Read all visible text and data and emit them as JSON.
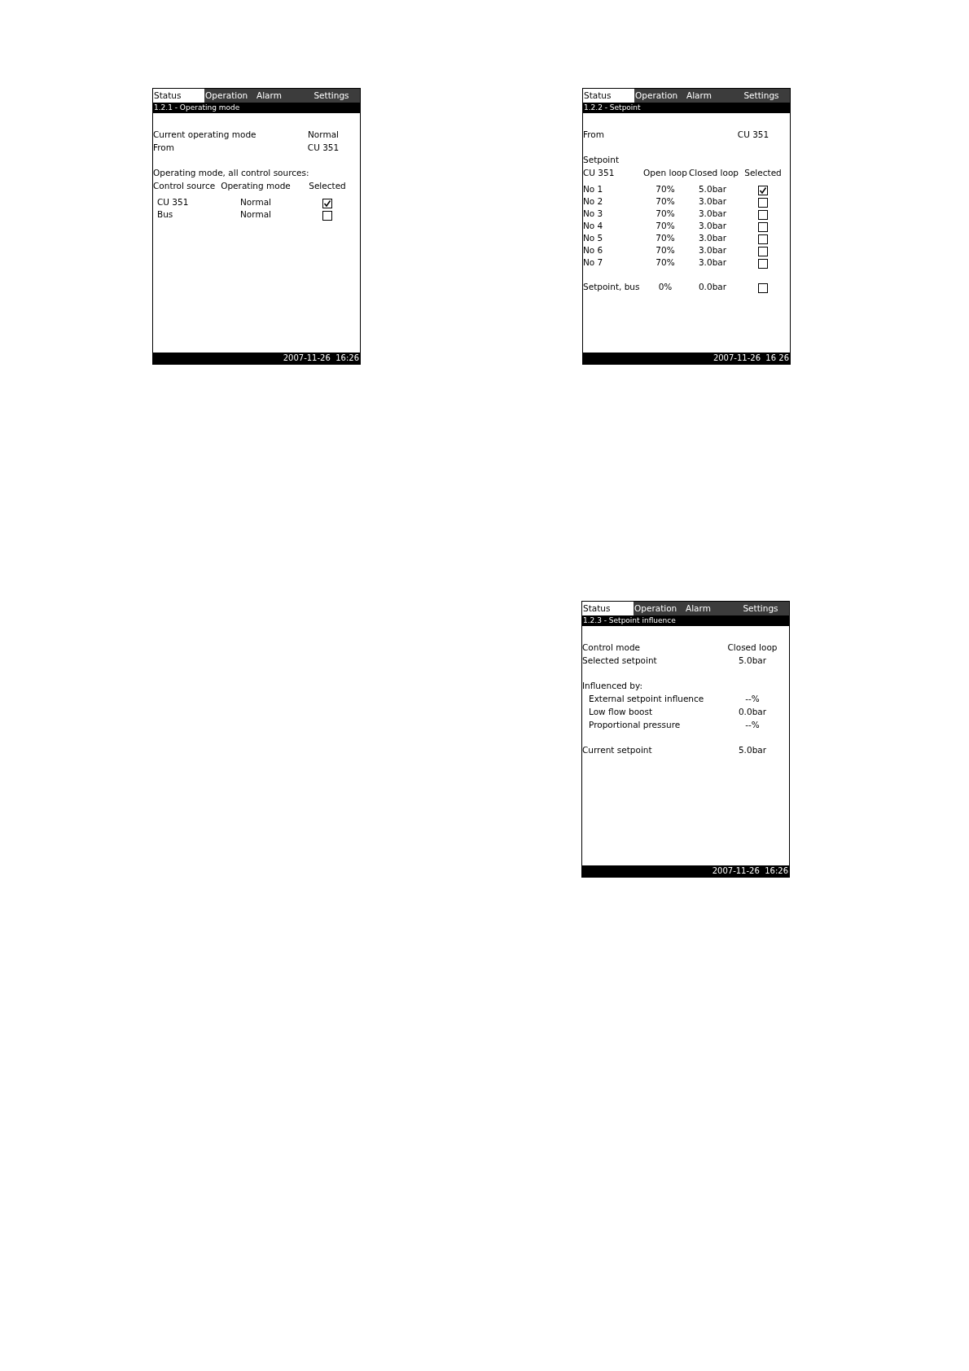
{
  "screens": [
    {
      "tabs": [
        {
          "label": "Status",
          "selected": true
        },
        {
          "label": "Operation",
          "selected": false
        },
        {
          "label": "Alarm",
          "selected": false
        },
        {
          "label": "Settings",
          "selected": false
        }
      ],
      "title": "1.2.1 - Operating mode",
      "sections": [
        [
          {
            "kind": "pair",
            "label": "Current operating mode",
            "value": "Normal"
          },
          {
            "kind": "pair",
            "label": "From",
            "value": "CU 351"
          }
        ],
        [
          {
            "kind": "text",
            "text": "Operating mode, all control sources:"
          },
          {
            "kind": "table",
            "columns": [
              "Control source",
              "Operating mode",
              "Selected"
            ],
            "rows": [
              {
                "cells": [
                  "CU 351",
                  "Normal"
                ],
                "checked": true
              },
              {
                "cells": [
                  "Bus",
                  "Normal"
                ],
                "checked": false
              }
            ]
          }
        ]
      ],
      "footer": "2007-11-26  16:26"
    },
    {
      "tabs": [
        {
          "label": "Status",
          "selected": true
        },
        {
          "label": "Operation",
          "selected": false
        },
        {
          "label": "Alarm",
          "selected": false
        },
        {
          "label": "Settings",
          "selected": false
        }
      ],
      "title": "1.2.2 - Setpoint",
      "sections": [
        [
          {
            "kind": "pair",
            "label": "From",
            "value": "CU 351"
          }
        ],
        [
          {
            "kind": "text",
            "text": "Setpoint"
          },
          {
            "kind": "table",
            "columns": [
              "CU 351",
              "Open loop",
              "Closed loop",
              "Selected"
            ],
            "rows": [
              {
                "cells": [
                  "No 1",
                  "70%",
                  "5.0bar"
                ],
                "checked": true
              },
              {
                "cells": [
                  "No 2",
                  "70%",
                  "3.0bar"
                ],
                "checked": false
              },
              {
                "cells": [
                  "No 3",
                  "70%",
                  "3.0bar"
                ],
                "checked": false
              },
              {
                "cells": [
                  "No 4",
                  "70%",
                  "3.0bar"
                ],
                "checked": false
              },
              {
                "cells": [
                  "No 5",
                  "70%",
                  "3.0bar"
                ],
                "checked": false
              },
              {
                "cells": [
                  "No 6",
                  "70%",
                  "3.0bar"
                ],
                "checked": false
              },
              {
                "cells": [
                  "No 7",
                  "70%",
                  "3.0bar"
                ],
                "checked": false
              }
            ]
          }
        ],
        [
          {
            "kind": "table",
            "rows": [
              {
                "cells": [
                  "Setpoint, bus",
                  "0%",
                  "0.0bar"
                ],
                "checked": false
              }
            ]
          }
        ]
      ],
      "footer": "2007-11-26  16 26"
    },
    {
      "tabs": [
        {
          "label": "Status",
          "selected": true
        },
        {
          "label": "Operation",
          "selected": false
        },
        {
          "label": "Alarm",
          "selected": false
        },
        {
          "label": "Settings",
          "selected": false
        }
      ],
      "title": "1.2.3 - Setpoint influence",
      "sections": [
        [
          {
            "kind": "pair",
            "label": "Control mode",
            "value": "Closed loop"
          },
          {
            "kind": "pair",
            "label": "Selected setpoint",
            "value": "5.0bar"
          }
        ],
        [
          {
            "kind": "text",
            "text": "Influenced by:"
          },
          {
            "kind": "subpair",
            "label": "External setpoint influence",
            "value": "--%"
          },
          {
            "kind": "subpair",
            "label": "Low flow boost",
            "value": "0.0bar"
          },
          {
            "kind": "subpair",
            "label": "Proportional pressure",
            "value": "--%"
          }
        ],
        [
          {
            "kind": "pair",
            "label": "Current setpoint",
            "value": "5.0bar"
          }
        ]
      ],
      "footer": "2007-11-26  16:26"
    }
  ]
}
